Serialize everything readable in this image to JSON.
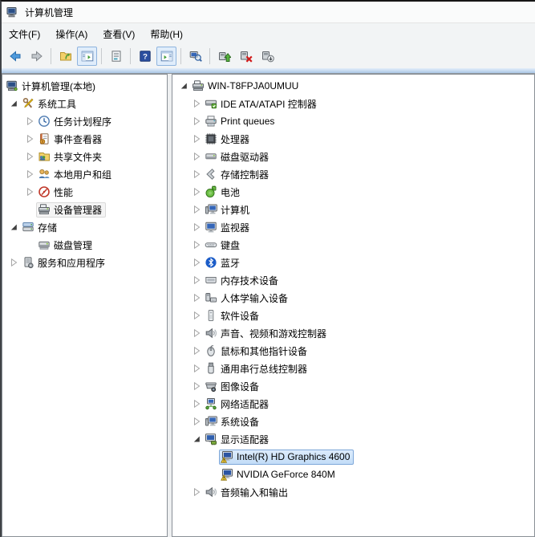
{
  "window": {
    "title": "计算机管理",
    "icon": "window-computer-icon"
  },
  "menu_bar": {
    "items": [
      {
        "name": "menu-file",
        "label": "文件(F)"
      },
      {
        "name": "menu-action",
        "label": "操作(A)"
      },
      {
        "name": "menu-view",
        "label": "查看(V)"
      },
      {
        "name": "menu-help",
        "label": "帮助(H)"
      }
    ]
  },
  "toolbar": {
    "buttons": [
      {
        "type": "button",
        "name": "back-button",
        "icon": "arrow-left-icon"
      },
      {
        "type": "button",
        "name": "forward-button",
        "icon": "arrow-right-icon"
      },
      {
        "type": "separator"
      },
      {
        "type": "button",
        "name": "up-one-level-button",
        "icon": "folder-up-icon"
      },
      {
        "type": "button",
        "name": "show-console-tree-button",
        "icon": "console-tree-icon",
        "pressed": true
      },
      {
        "type": "separator"
      },
      {
        "type": "button",
        "name": "export-list-button",
        "icon": "export-list-icon"
      },
      {
        "type": "separator"
      },
      {
        "type": "button",
        "name": "help-button",
        "icon": "help-icon"
      },
      {
        "type": "button",
        "name": "show-action-pane-button",
        "icon": "action-pane-icon",
        "pressed": true
      },
      {
        "type": "separator"
      },
      {
        "type": "button",
        "name": "scan-hardware-button",
        "icon": "scan-hardware-icon"
      },
      {
        "type": "separator"
      },
      {
        "type": "button",
        "name": "update-driver-button",
        "icon": "update-driver-icon"
      },
      {
        "type": "button",
        "name": "uninstall-device-button",
        "icon": "uninstall-device-icon"
      },
      {
        "type": "button",
        "name": "disable-device-button",
        "icon": "disable-device-icon"
      }
    ]
  },
  "left_pane": {
    "items": [
      {
        "name": "tree-item-computer-management-local",
        "label": "计算机管理(本地)",
        "icon": "management-computer-icon",
        "level": 0,
        "expander": "none"
      },
      {
        "name": "tree-item-system-tools",
        "label": "系统工具",
        "icon": "system-tools-icon",
        "level": 1,
        "expander": "expanded"
      },
      {
        "name": "tree-item-task-scheduler",
        "label": "任务计划程序",
        "icon": "task-scheduler-icon",
        "level": 2,
        "expander": "collapsed"
      },
      {
        "name": "tree-item-event-viewer",
        "label": "事件查看器",
        "icon": "event-viewer-icon",
        "level": 2,
        "expander": "collapsed"
      },
      {
        "name": "tree-item-shared-folders",
        "label": "共享文件夹",
        "icon": "shared-folders-icon",
        "level": 2,
        "expander": "collapsed"
      },
      {
        "name": "tree-item-local-users-groups",
        "label": "本地用户和组",
        "icon": "local-users-icon",
        "level": 2,
        "expander": "collapsed"
      },
      {
        "name": "tree-item-performance",
        "label": "性能",
        "icon": "performance-icon",
        "level": 2,
        "expander": "collapsed"
      },
      {
        "name": "tree-item-device-manager",
        "label": "设备管理器",
        "icon": "device-manager-icon",
        "level": 2,
        "expander": "none",
        "selected": "inactive"
      },
      {
        "name": "tree-item-storage",
        "label": "存储",
        "icon": "storage-icon",
        "level": 1,
        "expander": "expanded"
      },
      {
        "name": "tree-item-disk-management",
        "label": "磁盘管理",
        "icon": "disk-management-icon",
        "level": 2,
        "expander": "none"
      },
      {
        "name": "tree-item-services-applications",
        "label": "服务和应用程序",
        "icon": "services-icon",
        "level": 1,
        "expander": "collapsed"
      }
    ]
  },
  "right_pane": {
    "items": [
      {
        "name": "tree-item-computer-root",
        "label": "WIN-T8FPJA0UMUU",
        "icon": "device-manager-icon",
        "level": 0,
        "expander": "expanded"
      },
      {
        "name": "tree-item-ide-controllers",
        "label": "IDE ATA/ATAPI 控制器",
        "icon": "ide-controller-icon",
        "level": 1,
        "expander": "collapsed"
      },
      {
        "name": "tree-item-print-queues",
        "label": "Print queues",
        "icon": "printer-icon",
        "level": 1,
        "expander": "collapsed"
      },
      {
        "name": "tree-item-processors",
        "label": "处理器",
        "icon": "processor-icon",
        "level": 1,
        "expander": "collapsed"
      },
      {
        "name": "tree-item-disk-drives",
        "label": "磁盘驱动器",
        "icon": "disk-drive-icon",
        "level": 1,
        "expander": "collapsed"
      },
      {
        "name": "tree-item-storage-controllers",
        "label": "存储控制器",
        "icon": "storage-controller-icon",
        "level": 1,
        "expander": "collapsed"
      },
      {
        "name": "tree-item-batteries",
        "label": "电池",
        "icon": "battery-icon",
        "level": 1,
        "expander": "collapsed"
      },
      {
        "name": "tree-item-computer",
        "label": "计算机",
        "icon": "pc-icon",
        "level": 1,
        "expander": "collapsed"
      },
      {
        "name": "tree-item-monitors",
        "label": "监视器",
        "icon": "monitor-icon",
        "level": 1,
        "expander": "collapsed"
      },
      {
        "name": "tree-item-keyboards",
        "label": "键盘",
        "icon": "keyboard-icon",
        "level": 1,
        "expander": "collapsed"
      },
      {
        "name": "tree-item-bluetooth",
        "label": "蓝牙",
        "icon": "bluetooth-icon",
        "level": 1,
        "expander": "collapsed"
      },
      {
        "name": "tree-item-memory-devices",
        "label": "内存技术设备",
        "icon": "memory-icon",
        "level": 1,
        "expander": "collapsed"
      },
      {
        "name": "tree-item-hid-devices",
        "label": "人体学输入设备",
        "icon": "hid-icon",
        "level": 1,
        "expander": "collapsed"
      },
      {
        "name": "tree-item-software-devices",
        "label": "软件设备",
        "icon": "software-device-icon",
        "level": 1,
        "expander": "collapsed"
      },
      {
        "name": "tree-item-sound-controllers",
        "label": "声音、视频和游戏控制器",
        "icon": "audio-icon",
        "level": 1,
        "expander": "collapsed"
      },
      {
        "name": "tree-item-mice",
        "label": "鼠标和其他指针设备",
        "icon": "mouse-icon",
        "level": 1,
        "expander": "collapsed"
      },
      {
        "name": "tree-item-usb-controllers",
        "label": "通用串行总线控制器",
        "icon": "usb-icon",
        "level": 1,
        "expander": "collapsed"
      },
      {
        "name": "tree-item-imaging-devices",
        "label": "图像设备",
        "icon": "imaging-icon",
        "level": 1,
        "expander": "collapsed"
      },
      {
        "name": "tree-item-network-adapters",
        "label": "网络适配器",
        "icon": "network-icon",
        "level": 1,
        "expander": "collapsed"
      },
      {
        "name": "tree-item-system-devices",
        "label": "系统设备",
        "icon": "system-device-icon",
        "level": 1,
        "expander": "collapsed"
      },
      {
        "name": "tree-item-display-adapters",
        "label": "显示适配器",
        "icon": "display-adapter-icon",
        "level": 1,
        "expander": "expanded"
      },
      {
        "name": "tree-item-intel-hd-graphics",
        "label": "Intel(R) HD Graphics 4600",
        "icon": "display-warning-icon",
        "level": 2,
        "expander": "none",
        "selected": "active"
      },
      {
        "name": "tree-item-nvidia-geforce",
        "label": "NVIDIA GeForce 840M",
        "icon": "display-warning-icon",
        "level": 2,
        "expander": "none"
      },
      {
        "name": "tree-item-audio-inputs-outputs",
        "label": "音频输入和输出",
        "icon": "audio-io-icon",
        "level": 1,
        "expander": "collapsed"
      }
    ]
  },
  "colors": {
    "selection_border": "#7fa8d9",
    "selection_bg_top": "#ddecfd",
    "selection_bg_bottom": "#c2dcf7",
    "inactive_selection_bg": "#f4f4f4",
    "inactive_selection_border": "#d9d9d9",
    "warning_badge": "#ffd83d",
    "toolbar_pressed_bg": "#e0edfb"
  }
}
